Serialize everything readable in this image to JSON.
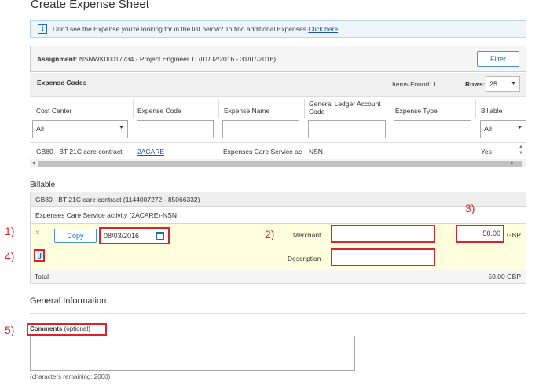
{
  "page_title": "Create Expense Sheet",
  "info_banner": {
    "icon": "info-icon",
    "text": "Don't see the Expense you're looking for in the list below? To find additional Expenses",
    "link": "Click here"
  },
  "assignment": {
    "label": "Assignment:",
    "value": "NSNWK00017734 - Project Engineer TI (01/02/2016 - 31/07/2016)",
    "filter_button": "Filter"
  },
  "expense_codes": {
    "title": "Expense Codes",
    "items_found": "Items Found:  1",
    "rows_label": "Rows:",
    "rows_value": "25",
    "columns": [
      "Cost Center",
      "Expense Code",
      "Expense Name",
      "General Ledger Account Code",
      "Expense Type",
      "Billable"
    ],
    "filters": {
      "cost_center": "All",
      "billable": "All"
    },
    "rows": [
      {
        "cost_center": "GB80 - BT 21C care contract",
        "expense_code": "2ACARE",
        "expense_name": "Expenses Care Service ac",
        "gl_code": "NSN",
        "expense_type": "",
        "billable": "Yes"
      }
    ]
  },
  "billable": {
    "section_label": "Billable",
    "group_header": "GB80 - BT 21C care contract (1144007272 - 85066332)",
    "activity": "Expenses Care Service activity (2ACARE)-NSN",
    "remove_icon": "×",
    "copy_button": "Copy",
    "date_value": "08/03/2016",
    "merchant_label": "Merchant",
    "merchant_value": "",
    "amount_value": "50.00",
    "currency": "GBP",
    "description_label": "Description",
    "description_value": "",
    "total_label": "Total",
    "total_value": "50.00 GBP"
  },
  "general_info": {
    "title": "General Information",
    "comments_label": "Comments",
    "comments_optional": "(optional)",
    "comments_value": "",
    "chars_remaining": "(characters remaining: 2000)"
  },
  "annotations": {
    "n1": "1)",
    "n2": "2)",
    "n3": "3)",
    "n4": "4)",
    "n5": "5)"
  },
  "colors": {
    "highlight": "#d9232d",
    "link": "#1a55aa",
    "row_bg": "#ffffdd"
  }
}
